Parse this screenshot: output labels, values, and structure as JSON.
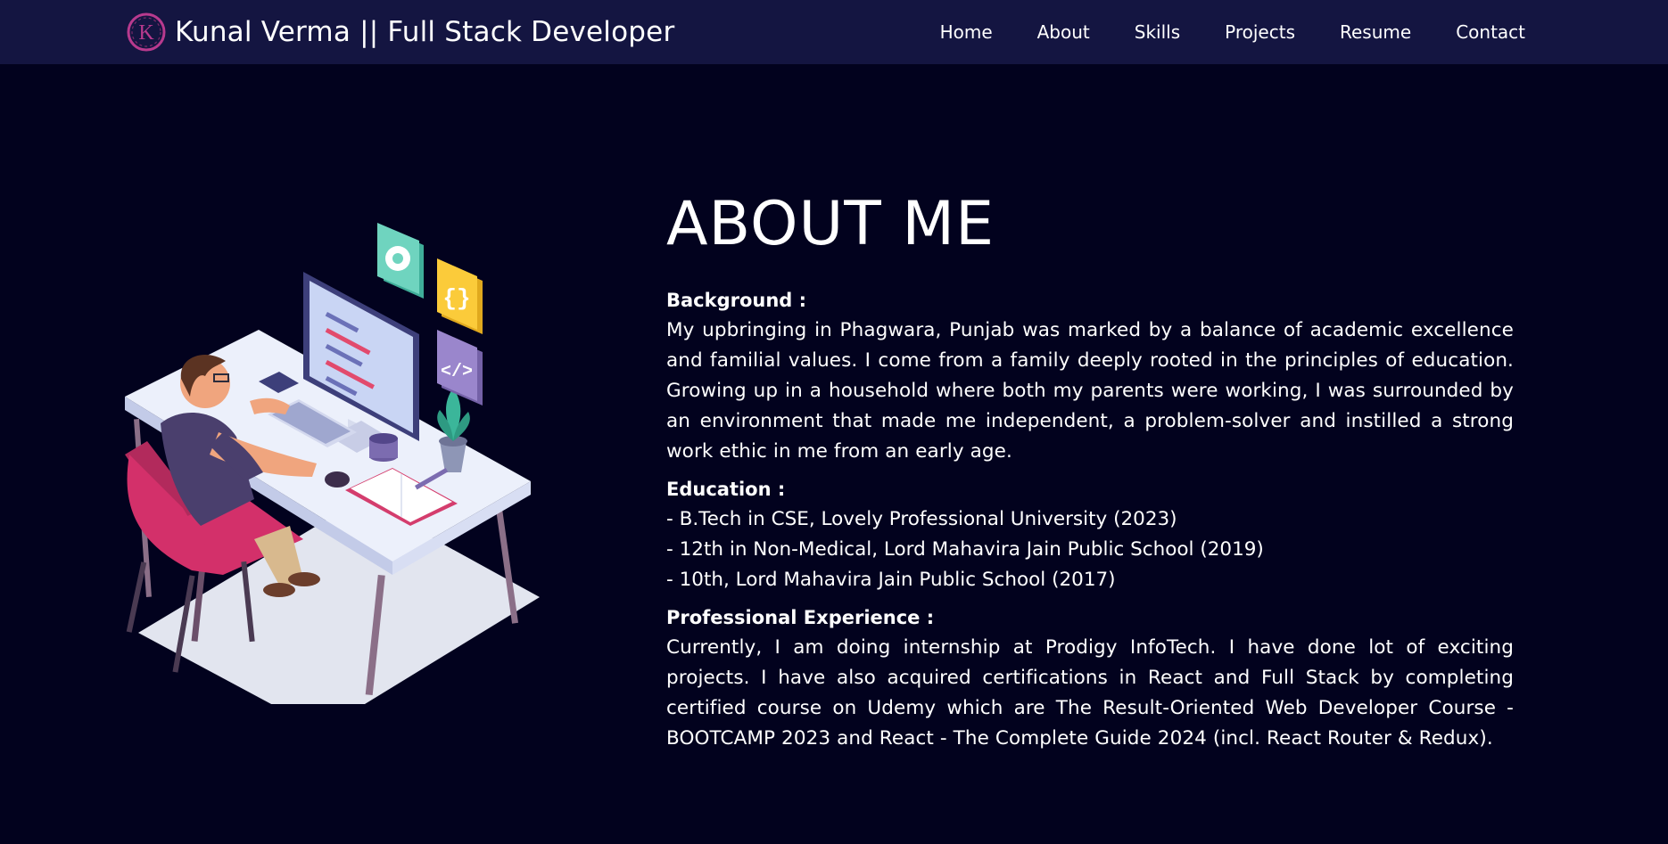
{
  "brand": {
    "logo_letter": "K",
    "title": "Kunal Verma || Full Stack Developer"
  },
  "nav": {
    "items": [
      "Home",
      "About",
      "Skills",
      "Projects",
      "Resume",
      "Contact"
    ]
  },
  "about": {
    "heading": "ABOUT ME",
    "background": {
      "title": "Background :",
      "text": "My upbringing in Phagwara, Punjab was marked by a balance of academic excellence and familial values. I come from a family deeply rooted in the principles of education. Growing up in a household where both my parents were working, I was surrounded by an environment that made me independent, a problem-solver and instilled a strong work ethic in me from an early age."
    },
    "education": {
      "title": "Education :",
      "items": [
        "- B.Tech in CSE, Lovely Professional University (2023)",
        "- 12th in Non-Medical, Lord Mahavira Jain Public School (2019)",
        "- 10th, Lord Mahavira Jain Public School (2017)"
      ]
    },
    "experience": {
      "title": "Professional Experience :",
      "text": "Currently, I am doing internship at Prodigy InfoTech. I have done lot of exciting projects. I have also acquired certifications in React and Full Stack by completing certified course on Udemy which are The Result-Oriented Web Developer Course - BOOTCAMP 2023 and React - The Complete Guide 2024 (incl. React Router & Redux)."
    }
  },
  "colors": {
    "page_background": "#02021e",
    "navbar_background": "#141541",
    "logo_accent": "#b83a8e",
    "text": "#ffffff"
  },
  "icons": [
    "logo-k-icon",
    "gear-icon",
    "curly-braces-icon",
    "code-tag-icon"
  ]
}
